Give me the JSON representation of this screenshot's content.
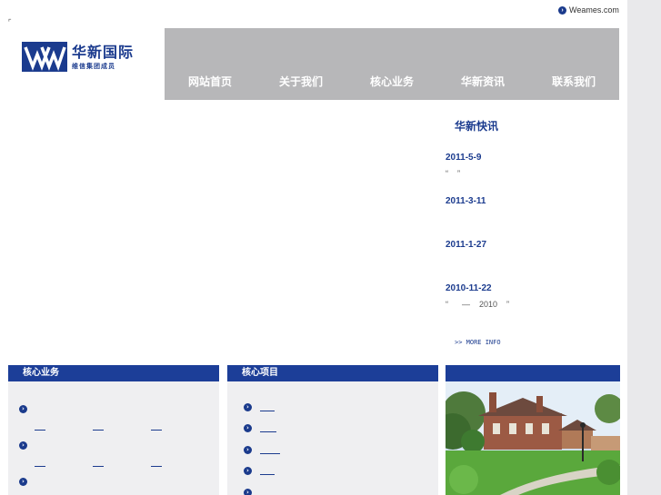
{
  "top_link": {
    "label": "Weames.com"
  },
  "logo": {
    "name": "华新国际",
    "subtitle": "维信集团成员"
  },
  "nav": {
    "items": [
      {
        "label": "网站首页"
      },
      {
        "label": "关于我们"
      },
      {
        "label": "核心业务"
      },
      {
        "label": "华新资讯"
      },
      {
        "label": "联系我们"
      }
    ]
  },
  "news": {
    "title": "华新快讯",
    "items": [
      {
        "date": "2011-5-9",
        "text": "“    ”"
      },
      {
        "date": "2011-3-11",
        "text": ""
      },
      {
        "date": "2011-1-27",
        "text": ""
      },
      {
        "date": "2010-11-22",
        "text": "“      —    2010    ”"
      }
    ],
    "more_label": ">> MORE INFO"
  },
  "panels": {
    "core_business": {
      "title": "核心业务"
    },
    "core_projects": {
      "title": "核心项目"
    }
  },
  "colors": {
    "brand_blue": "#1c3e98",
    "nav_gray": "#b7b7b9"
  }
}
